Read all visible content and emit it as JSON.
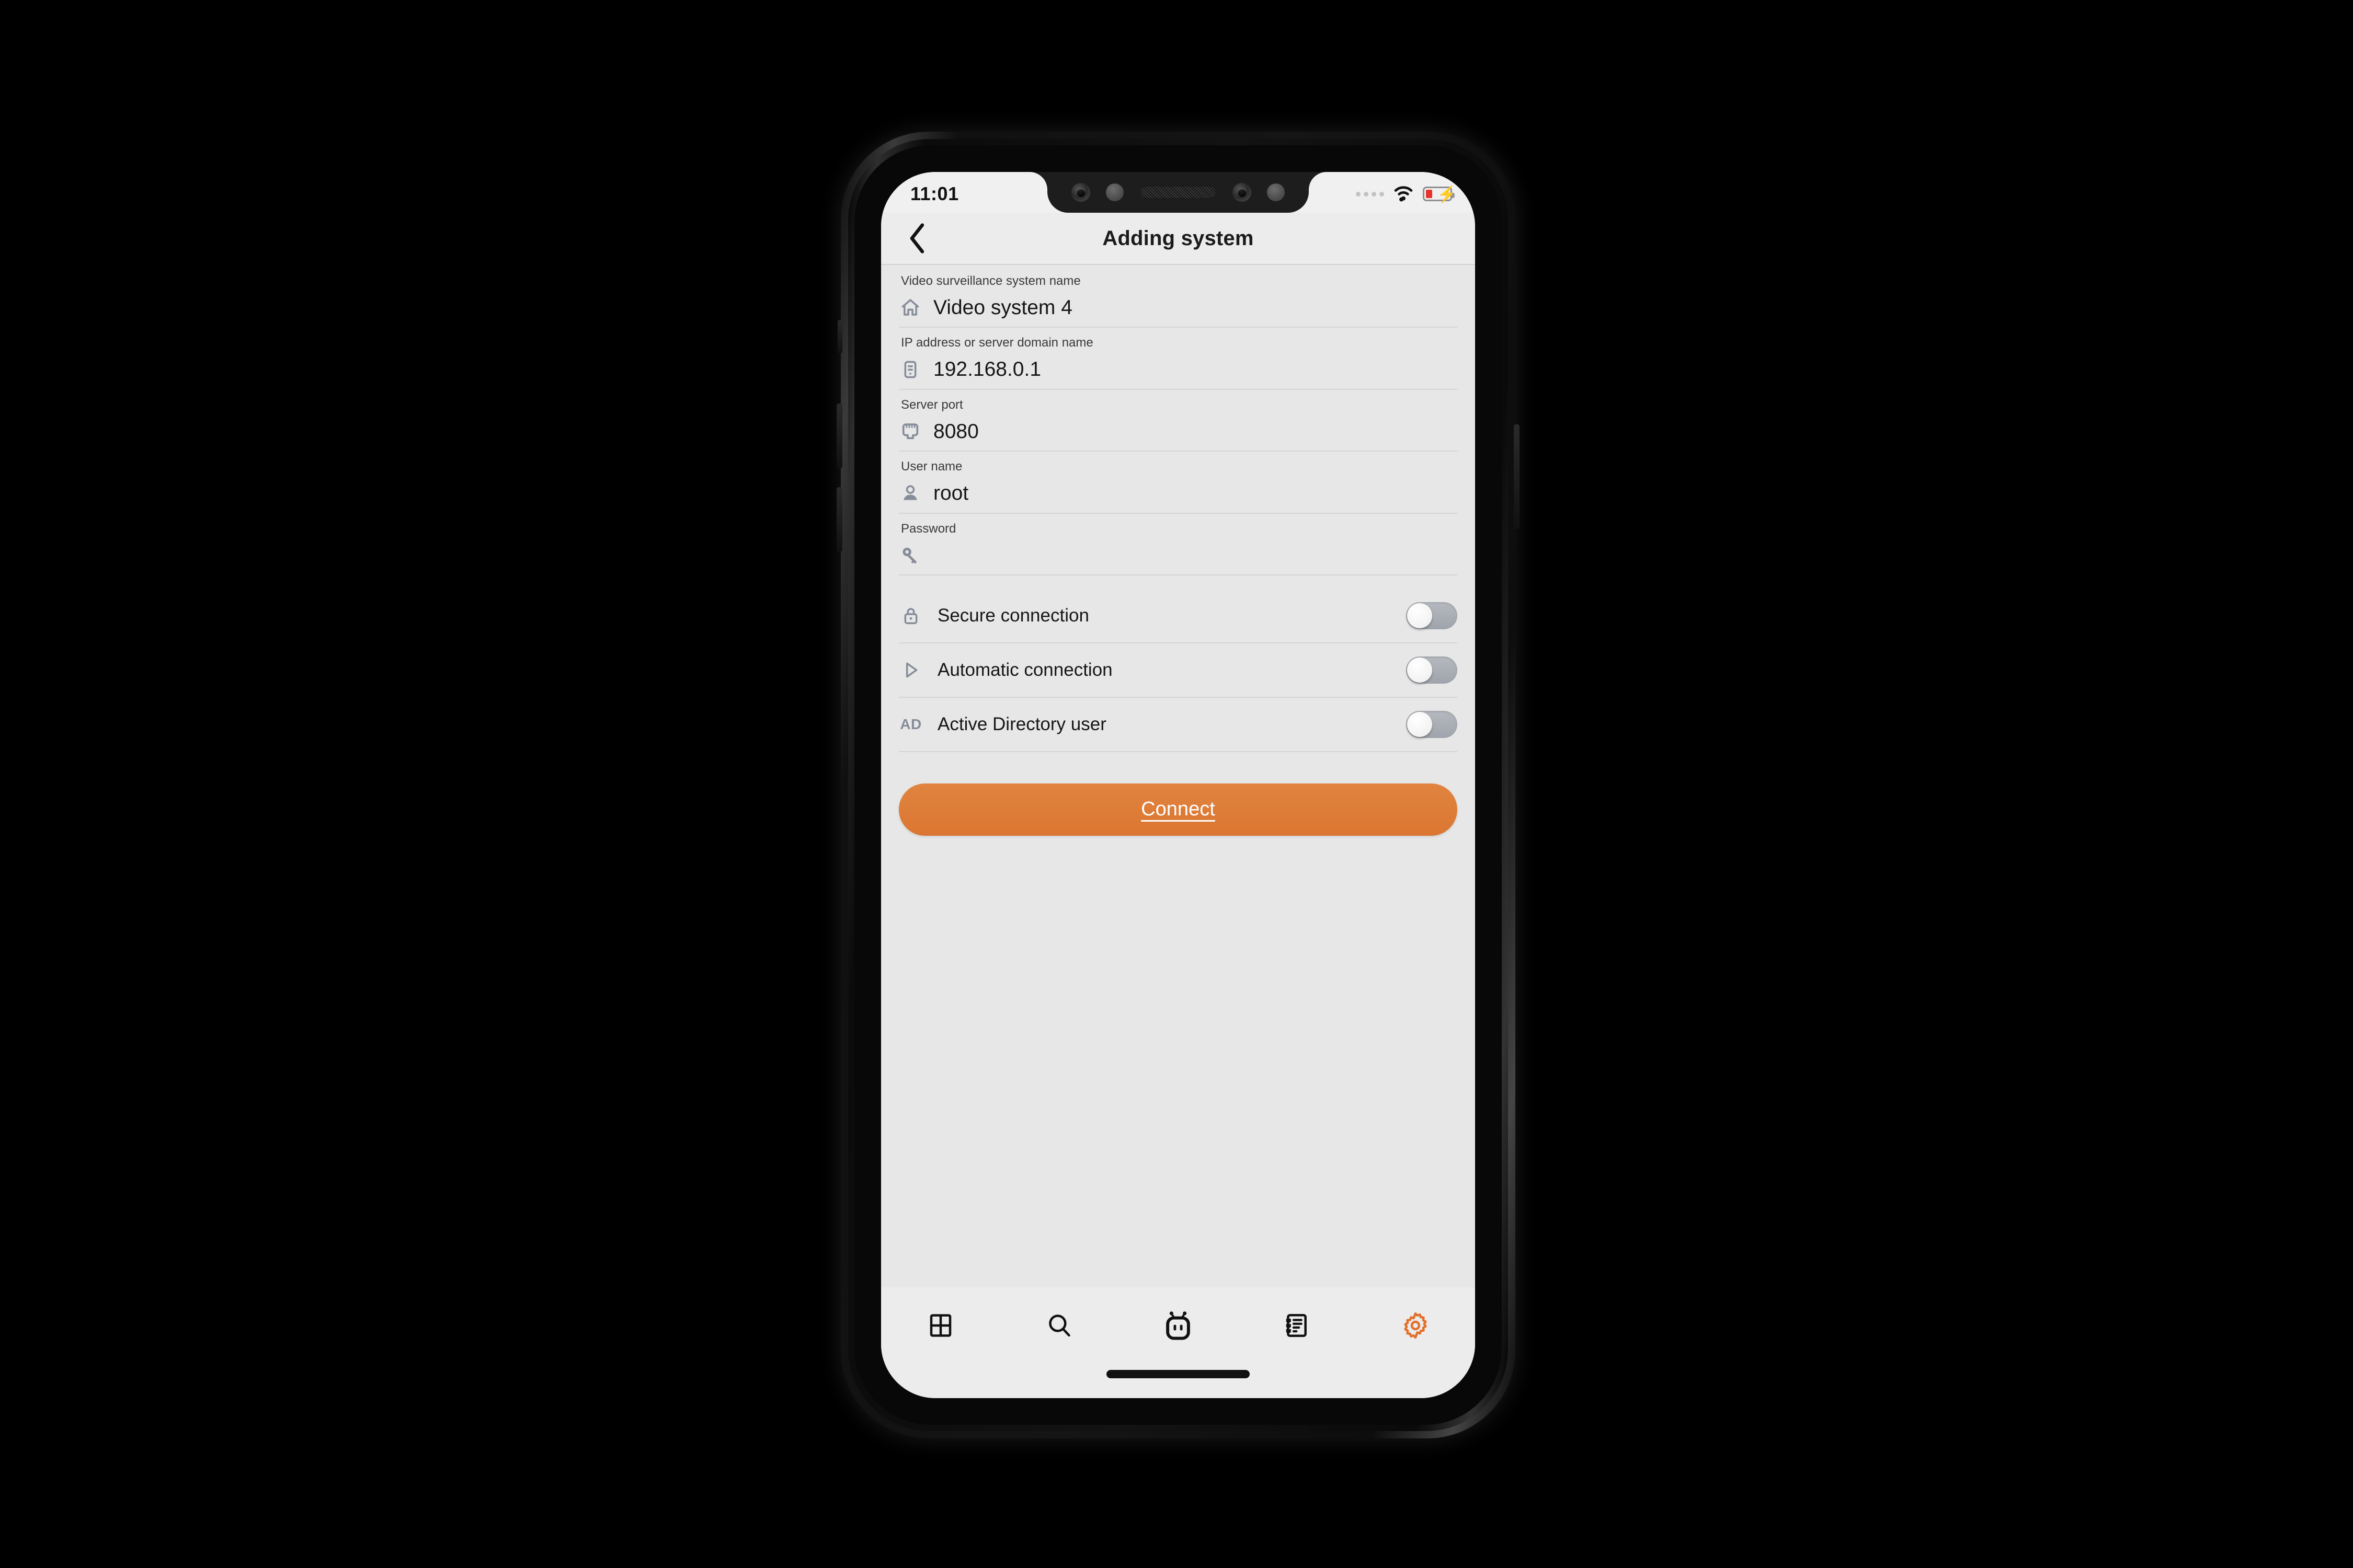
{
  "status_bar": {
    "clock": "11:01",
    "signal_dots": 4,
    "wifi_icon": "wifi-icon",
    "battery_icon": "battery-charging-icon",
    "battery_level_color": "#E8322B"
  },
  "nav": {
    "back_icon": "chevron-left-icon",
    "title": "Adding system"
  },
  "form": {
    "fields": [
      {
        "label": "Video surveillance system name",
        "value": "Video system 4",
        "icon": "home-icon",
        "name": "system-name"
      },
      {
        "label": "IP address or server domain name",
        "value": "192.168.0.1",
        "icon": "server-icon",
        "name": "server-address"
      },
      {
        "label": "Server port",
        "value": "8080",
        "icon": "ethernet-port-icon",
        "name": "server-port"
      },
      {
        "label": "User name",
        "value": "root",
        "icon": "user-icon",
        "name": "user-name"
      },
      {
        "label": "Password",
        "value": "",
        "icon": "key-icon",
        "name": "password"
      }
    ]
  },
  "toggles": [
    {
      "label": "Secure connection",
      "icon": "lock-icon",
      "state": "off",
      "name": "secure-connection"
    },
    {
      "label": "Automatic connection",
      "icon": "play-icon",
      "state": "off",
      "name": "automatic-connection"
    },
    {
      "label": "Active Directory user",
      "icon": "ad-text-icon",
      "state": "off",
      "name": "active-directory-user",
      "icon_text": "AD"
    }
  ],
  "primary_action": {
    "label": "Connect",
    "color": "#DE7B37",
    "text_color": "#FFFFFF"
  },
  "tab_bar": {
    "items": [
      {
        "icon": "grid-layout-icon",
        "name": "tab-layouts",
        "active": false
      },
      {
        "icon": "search-icon",
        "name": "tab-search",
        "active": false
      },
      {
        "icon": "robot-icon",
        "name": "tab-assistant",
        "active": false
      },
      {
        "icon": "report-list-icon",
        "name": "tab-reports",
        "active": false
      },
      {
        "icon": "gear-icon",
        "name": "tab-settings",
        "active": true
      }
    ],
    "active_color": "#E2702C",
    "inactive_color": "#111111"
  },
  "theme": {
    "screen_background": "#E7E7E7",
    "header_background": "#ECECEC",
    "separator": "#D5D5D5",
    "icon_gray": "#868C99",
    "text_primary": "#161616",
    "label_color": "#3A3A3A"
  }
}
